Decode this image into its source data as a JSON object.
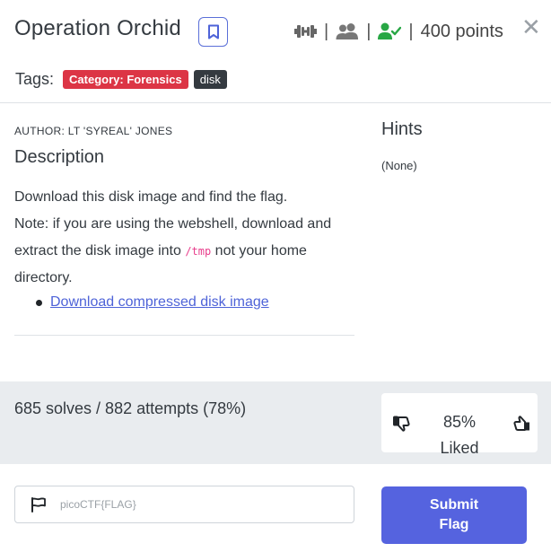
{
  "challenge": {
    "title": "Operation Orchid",
    "points": "400 points",
    "separator": "|"
  },
  "tags": {
    "label": "Tags:",
    "items": [
      "Category: Forensics",
      "disk"
    ]
  },
  "author": "AUTHOR: LT 'SYREAL' JONES",
  "description": {
    "heading": "Description",
    "line1": "Download this disk image and find the flag.",
    "line2_prefix": "Note: if you are using the webshell, download and extract the disk image into ",
    "line2_code": "/tmp",
    "line2_suffix": " not your home directory.",
    "link": "Download compressed disk image"
  },
  "hints": {
    "heading": "Hints",
    "value": "(None)"
  },
  "stats": {
    "solves": "685 solves / 882 attempts (78%)",
    "liked_percent": "85%",
    "liked_label": "Liked"
  },
  "flag_form": {
    "placeholder": "picoCTF{FLAG}",
    "submit_label_line1": "Submit",
    "submit_label_line2": "Flag"
  },
  "colors": {
    "accent": "#5563df",
    "tag_category": "#dc3545",
    "tag_disk": "#343a40",
    "solved_icon": "#28a745"
  },
  "icons": [
    "bookmark-icon",
    "dumbbell-icon",
    "users-icon",
    "user-check-icon",
    "close-icon",
    "thumbs-down-icon",
    "thumbs-up-icon",
    "flag-icon"
  ]
}
